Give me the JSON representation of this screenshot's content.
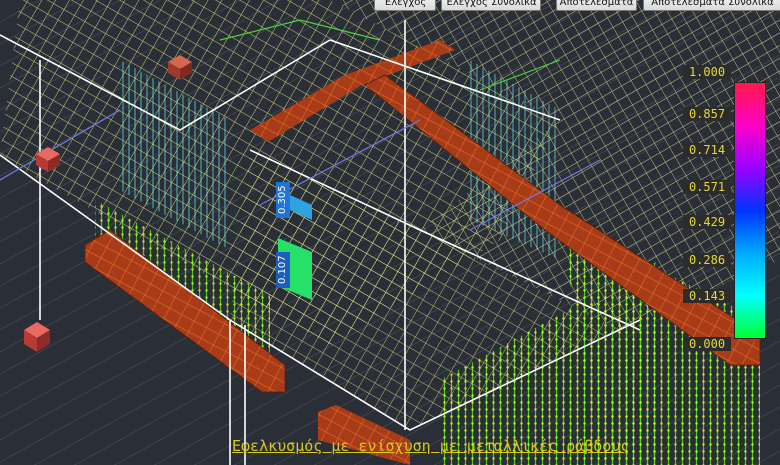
{
  "toolbar": {
    "buttons": [
      "Έλεγχος",
      "Έλεγχος Συνολικά",
      "Αποτελέσματα",
      "Αποτελέσματα Συνολικά"
    ]
  },
  "legend": {
    "labels": [
      "1.000",
      "0.857",
      "0.714",
      "0.571",
      "0.429",
      "0.286",
      "0.143",
      "0.000"
    ],
    "gradient": [
      "#ff1a4a",
      "#ff00c8",
      "#9a00ff",
      "#0033ff",
      "#00aaff",
      "#00ffff",
      "#00ff33"
    ]
  },
  "tags": {
    "value_1": "0.305",
    "value_2": "0.107"
  },
  "caption": "Εφελκυσμός με ενίσχυση με μεταλλικές ράβδους",
  "colors": {
    "background": "#2a2e36",
    "mesh": "#e8ec8a",
    "edges": "#ffffff",
    "beams": "#b8451b",
    "support": "#c43a35",
    "accent_text": "#e6d93a"
  }
}
